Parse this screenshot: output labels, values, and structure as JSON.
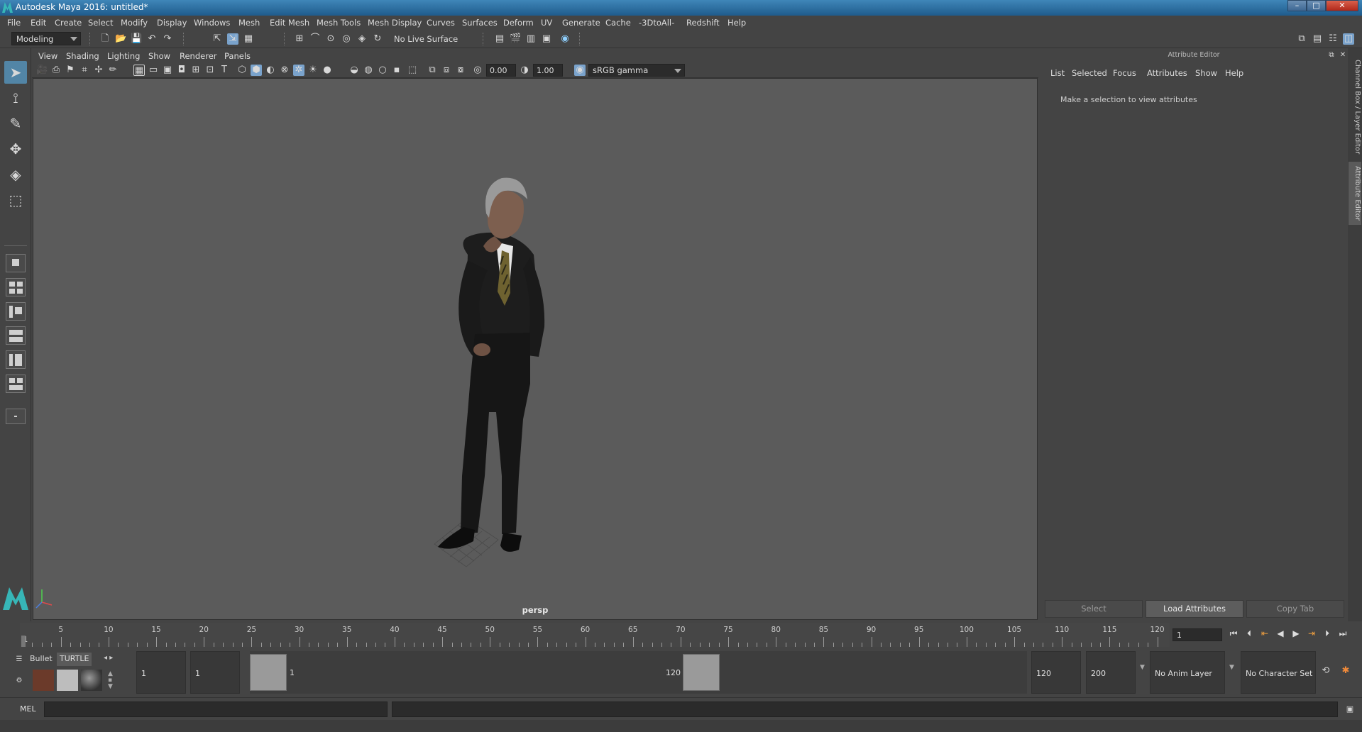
{
  "window": {
    "title": "Autodesk Maya 2016: untitled*",
    "minimize": "–",
    "restore": "□",
    "close": "✕"
  },
  "menubar": [
    "File",
    "Edit",
    "Create",
    "Select",
    "Modify",
    "Display",
    "Windows",
    "Mesh",
    "Edit Mesh",
    "Mesh Tools",
    "Mesh Display",
    "Curves",
    "Surfaces",
    "Deform",
    "UV",
    "Generate",
    "Cache",
    "-3DtoAll-",
    "Redshift",
    "Help"
  ],
  "statusline": {
    "mode": "Modeling",
    "live_surface": "No Live Surface"
  },
  "panel": {
    "menu": [
      "View",
      "Shading",
      "Lighting",
      "Show",
      "Renderer",
      "Panels"
    ],
    "exposure": "0.00",
    "gamma": "1.00",
    "color_space": "sRGB gamma",
    "camera_label": "persp"
  },
  "attribute_editor": {
    "title": "Attribute Editor",
    "menu": [
      "List",
      "Selected",
      "Focus",
      "Attributes",
      "Show",
      "Help"
    ],
    "message": "Make a selection to view attributes",
    "buttons": {
      "select": "Select",
      "load": "Load Attributes",
      "copy": "Copy Tab"
    }
  },
  "side_tabs": {
    "channel_box": "Channel Box / Layer Editor",
    "attribute_editor": "Attribute Editor"
  },
  "timeline": {
    "ticks": [
      "5",
      "10",
      "15",
      "20",
      "25",
      "30",
      "35",
      "40",
      "45",
      "50",
      "55",
      "60",
      "65",
      "70",
      "75",
      "80",
      "85",
      "90",
      "95",
      "100",
      "105",
      "110",
      "115",
      "120"
    ],
    "start_label": "1",
    "current_frame": "1"
  },
  "range": {
    "anim_start": "1",
    "playback_start": "1",
    "range_start_label": "1",
    "range_end_label": "120",
    "playback_end": "120",
    "anim_end": "200",
    "anim_layer": "No Anim Layer",
    "character_set": "No Character Set"
  },
  "shelf": {
    "tab_bullet": "Bullet",
    "tab_turtle": "TURTLE"
  },
  "command_line": {
    "label": "MEL"
  }
}
